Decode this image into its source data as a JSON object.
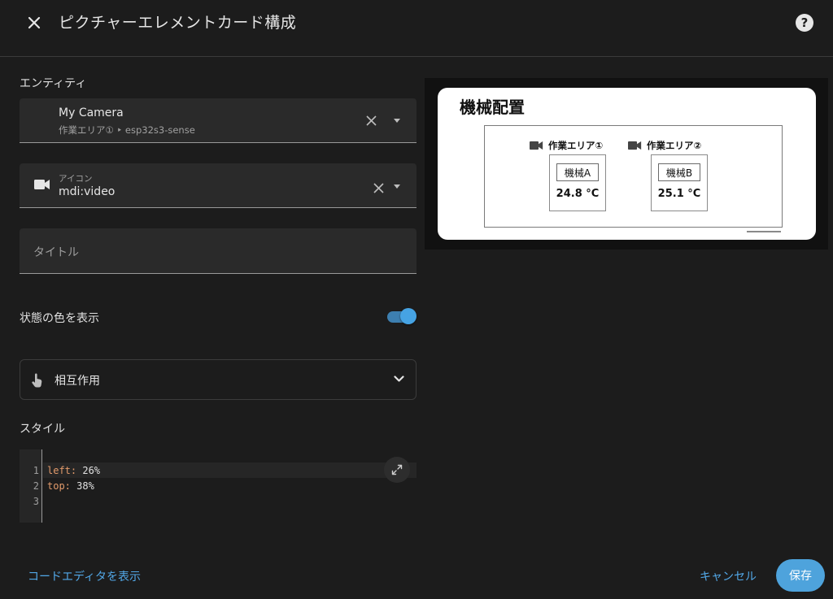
{
  "dialog": {
    "title": "ピクチャーエレメントカード構成"
  },
  "entity": {
    "label": "エンティティ",
    "value": "My Camera",
    "path": "作業エリア① ‣ esp32s3-sense"
  },
  "icon_field": {
    "label": "アイコン",
    "value": "mdi:video"
  },
  "title_field": {
    "placeholder": "タイトル"
  },
  "state_color": {
    "label": "状態の色を表示",
    "enabled": true
  },
  "interaction": {
    "label": "相互作用"
  },
  "style": {
    "label": "スタイル",
    "line_numbers": [
      "1",
      "2",
      "3"
    ],
    "lines": [
      {
        "key": "left:",
        "value": " 26%"
      },
      {
        "key": "top:",
        "value": " 38%"
      }
    ]
  },
  "footer": {
    "code_editor_label": "コードエディタを表示",
    "cancel_label": "キャンセル",
    "save_label": "保存"
  },
  "preview": {
    "title": "機械配置",
    "areas": [
      {
        "name": "作業エリア①",
        "machine": "機械A",
        "temperature": "24.8 °C"
      },
      {
        "name": "作業エリア②",
        "machine": "機械B",
        "temperature": "25.1 °C"
      }
    ]
  },
  "colors": {
    "accent": "#4ea3dc",
    "link": "#52a8e8",
    "background": "#1c1c1c",
    "field": "#2a2a2a"
  }
}
